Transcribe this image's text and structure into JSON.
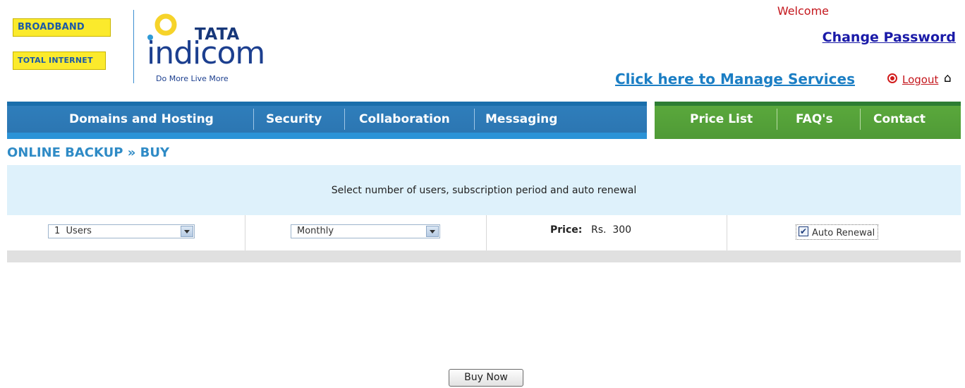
{
  "header": {
    "badges": [
      "BROADBAND",
      "TOTAL INTERNET"
    ],
    "brand": {
      "top": "TATA",
      "name": "indicom",
      "tagline": "Do More Live More"
    },
    "welcome": "Welcome",
    "change_password": "Change Password",
    "manage_services": "Click here to Manage Services",
    "logout": "Logout"
  },
  "nav": {
    "main": [
      "Domains and Hosting",
      "Security",
      "Collaboration",
      "Messaging"
    ],
    "side": [
      "Price List",
      "FAQ's",
      "Contact"
    ]
  },
  "breadcrumb": "ONLINE BACKUP » BUY",
  "form": {
    "instruction": "Select number of users, subscription period and auto renewal",
    "users": "1  Users",
    "period": "Monthly",
    "price_label": "Price:",
    "price_value": "Rs.  300",
    "auto_renewal_label": "Auto Renewal",
    "auto_renewal_checked": true,
    "buy_button": "Buy Now"
  },
  "colors": {
    "nav_blue": "#2c76b2",
    "nav_green": "#4f9a36",
    "band": "#def1fb",
    "link_red": "#c4161c"
  }
}
